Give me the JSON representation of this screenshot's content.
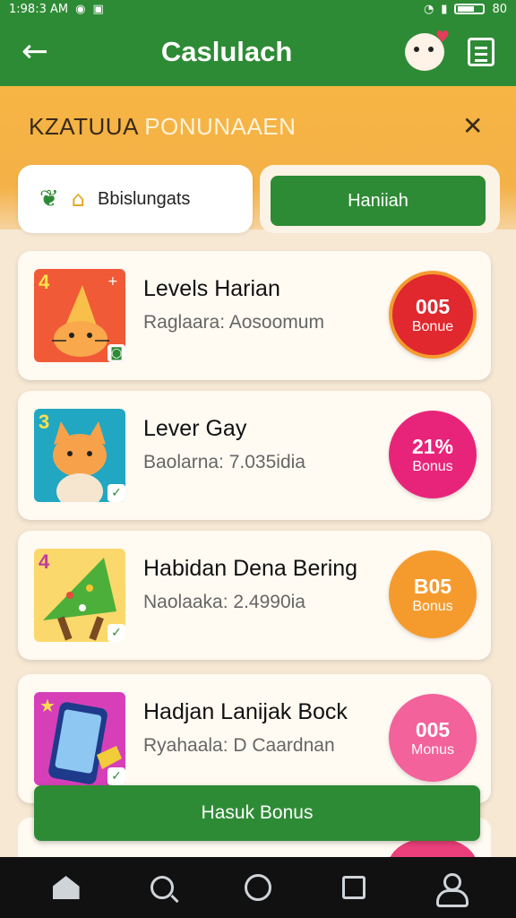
{
  "status_bar": {
    "time": "1:98:3 AM",
    "battery": "80",
    "icons": [
      "notification-icon",
      "image-icon",
      "wifi-icon",
      "signal-icon",
      "battery-icon"
    ]
  },
  "appbar": {
    "title": "Caslulach",
    "back_icon": "back-arrow-icon",
    "mascot_icon": "mascot-heart-icon",
    "doc_icon": "document-icon"
  },
  "banner": {
    "title_dark": "KZATUUA",
    "title_light": "PONUNAAEN",
    "close_icon": "close-icon"
  },
  "tabs": {
    "left_label": "Bbislungats",
    "right_label": "Haniiah"
  },
  "items": [
    {
      "title": "Levels Harian",
      "subtitle": "Raglaara: Aosoomum",
      "badge_value": "005",
      "badge_label": "Bonue",
      "badge_color": "#e0282e",
      "level": "4",
      "thumb_bg": "#f05a37",
      "thumb_shape": "orange-cat"
    },
    {
      "title": "Lever Gay",
      "subtitle": "Baolarna: 7.035idia",
      "badge_value": "21%",
      "badge_label": "Bonus",
      "badge_color": "#e8247a",
      "level": "3",
      "thumb_bg": "#21a7c2",
      "thumb_shape": "cat"
    },
    {
      "title": "Habidan Dena Bering",
      "subtitle": "Naolaaka: 2.4990ia",
      "badge_value": "B05",
      "badge_label": "Bonus",
      "badge_color": "#f59b2e",
      "level": "4",
      "thumb_bg": "#fbd86b",
      "thumb_shape": "tree"
    },
    {
      "title": "Hadjan Lanijak Bock",
      "subtitle": "Ryahaala: D Caardnan",
      "badge_value": "005",
      "badge_label": "Monus",
      "badge_color": "#f3629a",
      "level": "",
      "thumb_bg": "#d63fb8",
      "thumb_shape": "phone"
    }
  ],
  "cta_label": "Hasuk Bonus",
  "nav_icons": [
    "home-icon",
    "search-icon",
    "circle-icon",
    "square-icon",
    "profile-icon"
  ]
}
